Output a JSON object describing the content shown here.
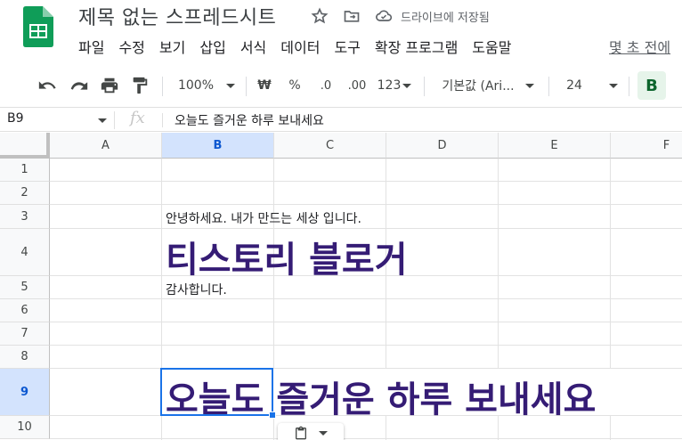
{
  "doc": {
    "title": "제목 없는 스프레드시트",
    "save_status": "드라이브에 저장됨",
    "last_edit": "몇 초 전에"
  },
  "menu": [
    "파일",
    "수정",
    "보기",
    "삽입",
    "서식",
    "데이터",
    "도구",
    "확장 프로그램",
    "도움말"
  ],
  "toolbar": {
    "zoom": "100%",
    "currency": "₩",
    "percent": "%",
    "dec_decrease": ".0",
    "dec_increase": ".00",
    "number_format": "123",
    "font_family": "기본값 (Ari...",
    "font_size": "24",
    "bold": "B"
  },
  "formula_bar": {
    "name_box": "B9",
    "fx": "fx",
    "content": "오늘도 즐거운 하루 보내세요"
  },
  "grid": {
    "columns": [
      "A",
      "B",
      "C",
      "D",
      "E",
      "F"
    ],
    "rows": [
      "1",
      "2",
      "3",
      "4",
      "5",
      "6",
      "7",
      "8",
      "9",
      "10"
    ],
    "selected_cell": "B9",
    "cells": {
      "B3": "안녕하세요. 내가 만드는 세상 입니다.",
      "B4": "티스토리 블로거",
      "B5": "감사합니다.",
      "B9": "오늘도 즐거운 하루 보내세요"
    }
  },
  "colors": {
    "accent": "#1a73e8",
    "large_text": "#351c75",
    "logo_green": "#0f9d58",
    "selected_header": "#d3e3fd"
  }
}
